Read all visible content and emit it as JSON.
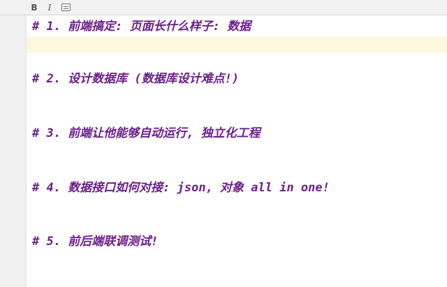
{
  "toolbar": {
    "bold_label": "B",
    "italic_label": "I"
  },
  "editor": {
    "lines": [
      "# 1. 前端搞定: 页面长什么样子: 数据",
      "# 2. 设计数据库 (数据库设计难点!)",
      "# 3. 前端让他能够自动运行, 独立化工程",
      "# 4. 数据接口如何对接: json, 对象 all in one!",
      "# 5. 前后端联调测试!"
    ]
  },
  "colors": {
    "text": "#6a1f8a",
    "current_line_highlight": "#fdf7de",
    "gutter": "#f0f0f0"
  }
}
